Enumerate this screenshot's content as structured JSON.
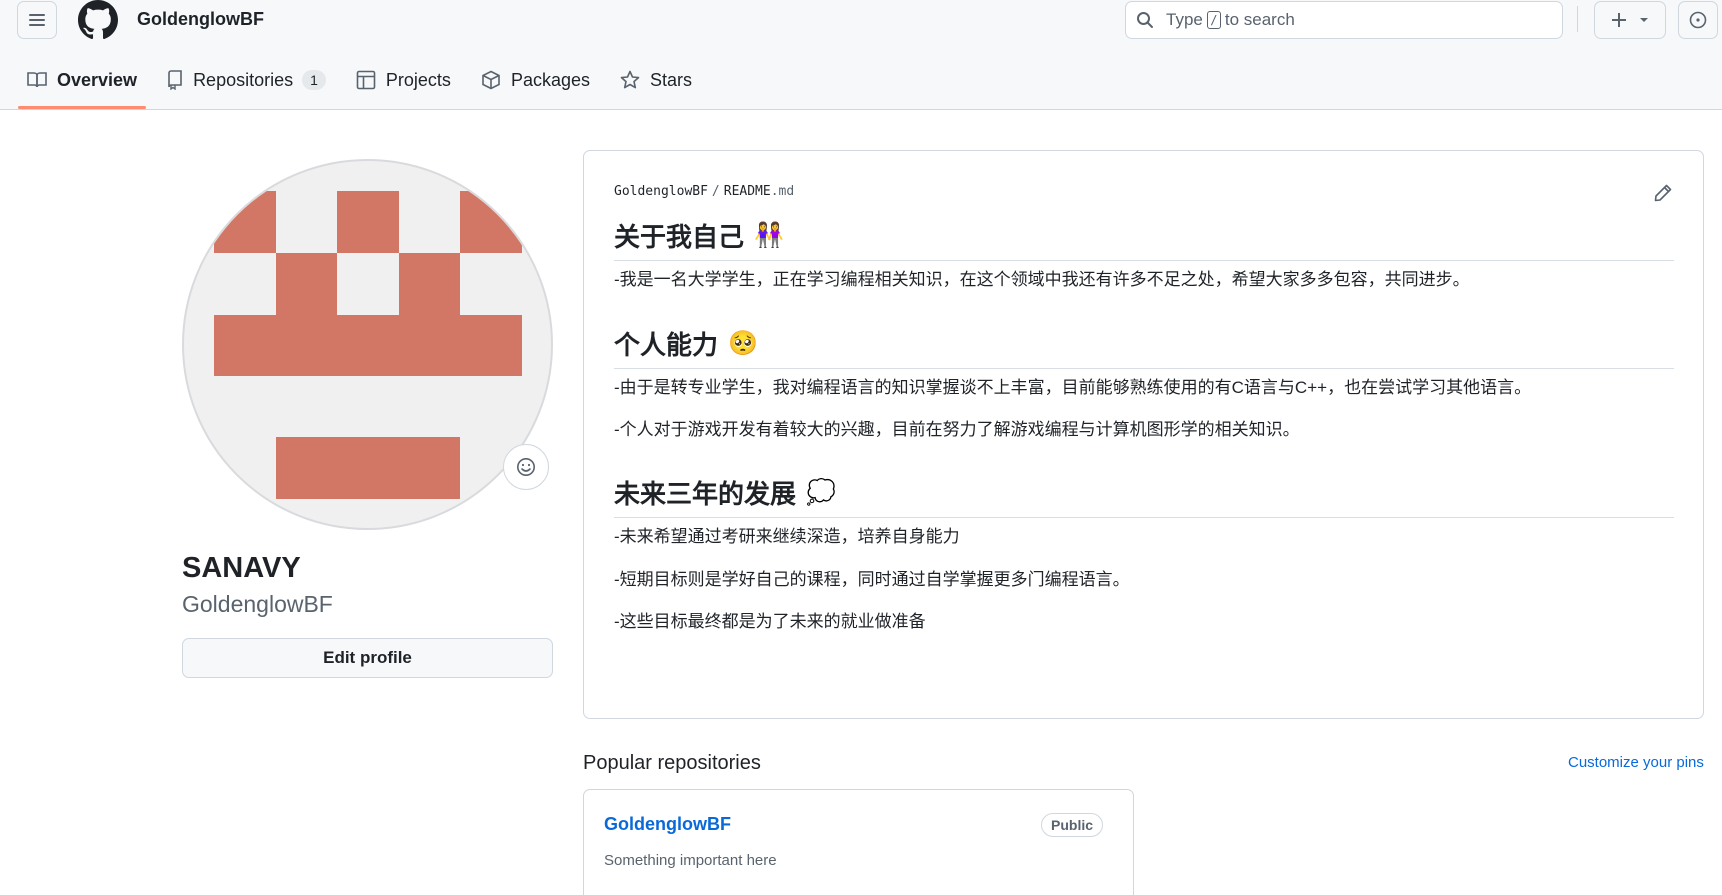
{
  "header": {
    "owner": "GoldenglowBF",
    "search": {
      "prefix": "Type",
      "key": "/",
      "suffix": "to search"
    }
  },
  "tabs": [
    {
      "label": "Overview",
      "icon": "book-icon",
      "active": true
    },
    {
      "label": "Repositories",
      "icon": "repo-icon",
      "count": "1"
    },
    {
      "label": "Projects",
      "icon": "table-icon"
    },
    {
      "label": "Packages",
      "icon": "package-icon"
    },
    {
      "label": "Stars",
      "icon": "star-icon"
    }
  ],
  "profile": {
    "name": "SANAVY",
    "login": "GoldenglowBF",
    "edit_label": "Edit profile",
    "avatar_color": "#d27665"
  },
  "readme": {
    "path_owner": "GoldenglowBF",
    "path_sep": "/",
    "path_file": "README",
    "path_ext": ".md",
    "sections": [
      {
        "heading": "关于我自己",
        "emoji": "👭",
        "paragraphs": [
          "-我是一名大学学生，正在学习编程相关知识，在这个领域中我还有许多不足之处，希望大家多多包容，共同进步。"
        ]
      },
      {
        "heading": "个人能力",
        "emoji": "🥺",
        "paragraphs": [
          "-由于是转专业学生，我对编程语言的知识掌握谈不上丰富，目前能够熟练使用的有C语言与C++，也在尝试学习其他语言。",
          "-个人对于游戏开发有着较大的兴趣，目前在努力了解游戏编程与计算机图形学的相关知识。"
        ]
      },
      {
        "heading": "未来三年的发展",
        "emoji": "💭",
        "paragraphs": [
          "-未来希望通过考研来继续深造，培养自身能力",
          "-短期目标则是学好自己的课程，同时通过自学掌握更多门编程语言。",
          "-这些目标最终都是为了未来的就业做准备"
        ]
      }
    ]
  },
  "popular": {
    "title": "Popular repositories",
    "customize": "Customize your pins",
    "repos": [
      {
        "name": "GoldenglowBF",
        "visibility": "Public",
        "description": "Something important here"
      }
    ]
  },
  "colors": {
    "accent": "#fd8c73",
    "link": "#0969da"
  }
}
